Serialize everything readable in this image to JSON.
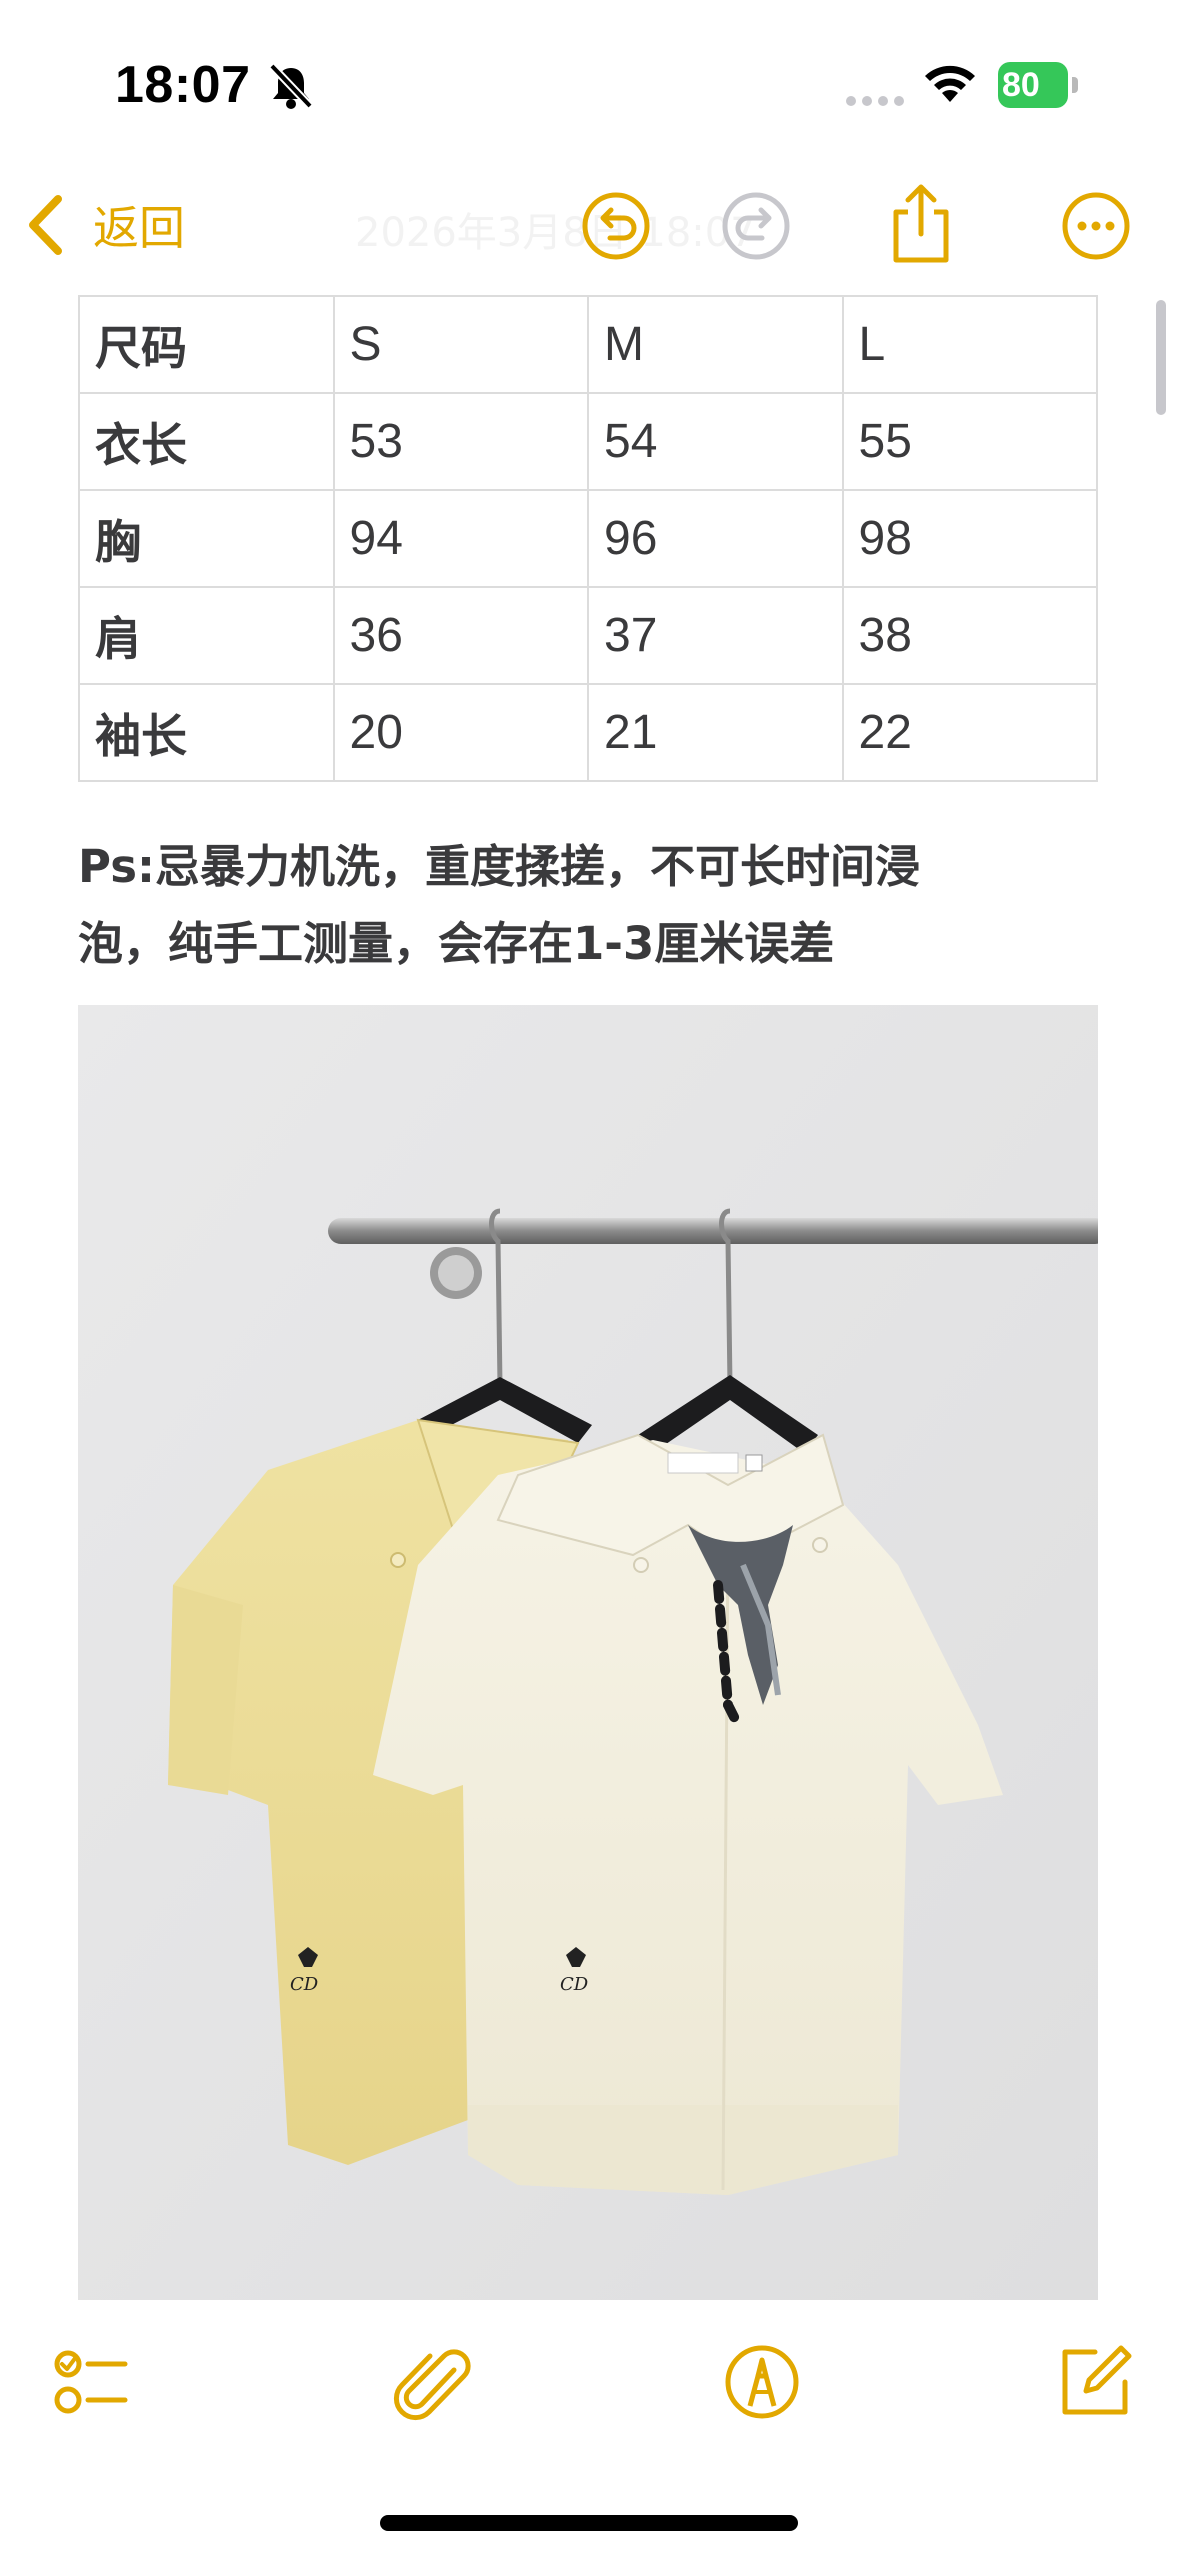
{
  "status_bar": {
    "time": "18:07",
    "battery": "80"
  },
  "toolbar": {
    "back_label": "返回",
    "faded_title": "2026年3月8日 18:07"
  },
  "size_table": {
    "rows": [
      [
        "尺码",
        "S",
        "M",
        "L"
      ],
      [
        "衣长",
        "53",
        "54",
        "55"
      ],
      [
        "胸",
        "94",
        "96",
        "98"
      ],
      [
        "肩",
        "36",
        "37",
        "38"
      ],
      [
        "袖长",
        "20",
        "21",
        "22"
      ]
    ]
  },
  "note": {
    "line1": "Ps:忌暴力机洗，重度揉搓，不可长时间浸",
    "line2": "泡，纯手工测量，会存在1-3厘米误差"
  },
  "colors": {
    "accent": "#e2a800",
    "text": "#3a3a3c",
    "battery": "#35c759"
  }
}
